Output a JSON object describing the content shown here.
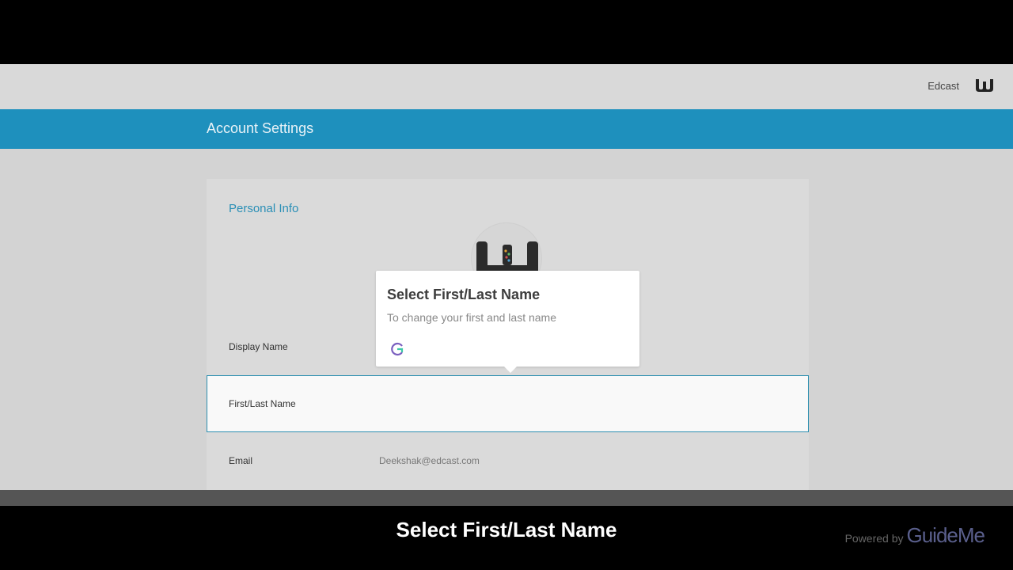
{
  "topbar": {
    "org_name": "Edcast",
    "logo_icon": "edcast-logo-icon"
  },
  "header": {
    "title": "Account Settings"
  },
  "personal_info": {
    "section_title": "Personal Info",
    "rows": [
      {
        "label": "Display Name",
        "value": ""
      },
      {
        "label": "First/Last Name",
        "value": ""
      },
      {
        "label": "Email",
        "value": "Deekshak@edcast.com"
      }
    ]
  },
  "tooltip": {
    "title": "Select First/Last Name",
    "description": "To change your first and last name",
    "icon": "guideme-logo-icon"
  },
  "footer": {
    "caption": "Select First/Last Name",
    "powered_by_label": "Powered by",
    "powered_by_brand": "GuideMe"
  },
  "colors": {
    "accent": "#1e90bd",
    "section_title": "#2a8fb6",
    "highlight_border": "#2c8fb0"
  }
}
